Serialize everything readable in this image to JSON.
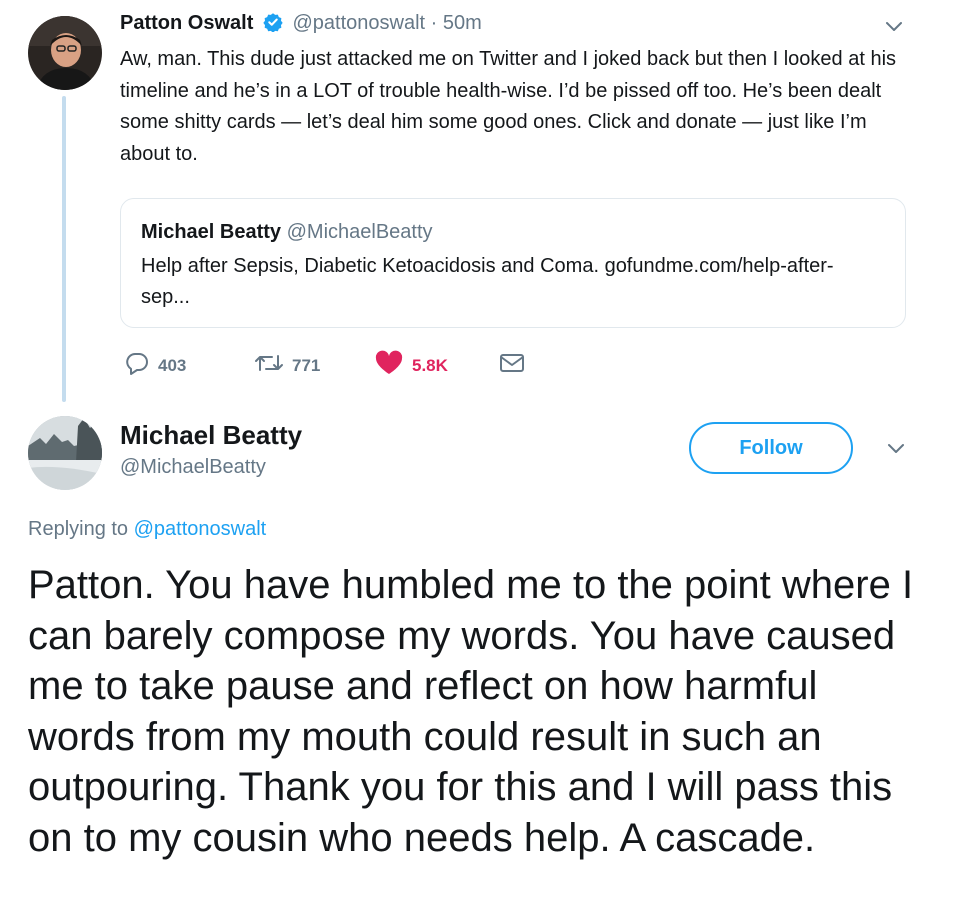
{
  "tweet": {
    "author_name": "Patton Oswalt",
    "author_handle": "@pattonoswalt",
    "time": "· 50m",
    "text": "Aw, man. This dude just attacked me on Twitter and I joked back but then I looked at his timeline and he’s in a LOT of trouble health-wise. I’d be pissed off too. He’s been dealt some shitty cards — let’s deal him some good ones. Click and donate — just like I’m about to.",
    "quoted": {
      "author_name": "Michael Beatty",
      "author_handle": "@MichaelBeatty",
      "text": "Help after Sepsis, Diabetic Ketoacidosis and Coma. gofundme.com/help-after-sep..."
    },
    "stats": {
      "replies": "403",
      "retweets": "771",
      "likes": "5.8K"
    }
  },
  "reply_tweet": {
    "author_name": "Michael Beatty",
    "author_handle": "@MichaelBeatty",
    "follow_label": "Follow",
    "replying_prefix": "Replying to",
    "replying_to": "@pattonoswalt",
    "text": "Patton. You have humbled me to the point where I can barely compose my words. You have caused me to take pause and reflect on how harmful words from my mouth could result in such an outpouring.  Thank you for this and I will pass this on to my cousin who needs help. A cascade."
  },
  "colors": {
    "accent": "#1da1f2",
    "like": "#e0245e",
    "secondary_text": "#657786",
    "thread_line": "#c4dcee"
  },
  "icons": [
    "verified-badge-icon",
    "chevron-down-icon",
    "reply-icon",
    "retweet-icon",
    "heart-icon",
    "direct-message-icon"
  ]
}
